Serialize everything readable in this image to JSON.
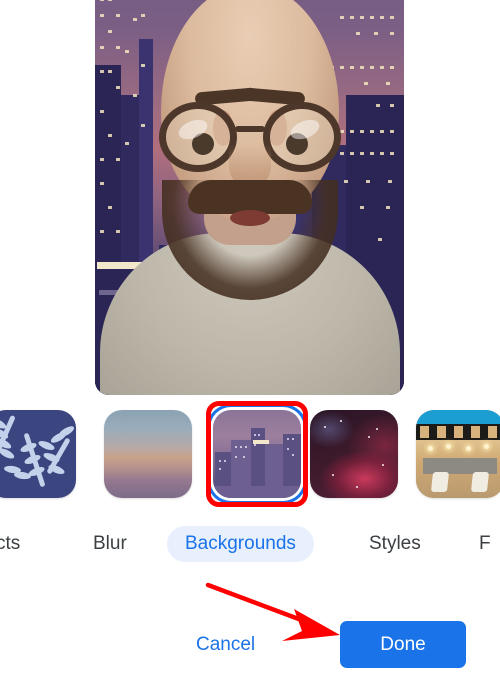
{
  "app": {
    "name": "video-call-background-effects-panel",
    "title": "Backgrounds"
  },
  "preview": {
    "name": "self-view-video-preview",
    "description": "Live self-view of a bearded person wearing glasses with a virtual night city skyline background applied",
    "alt_text": "Video preview"
  },
  "thumbnails": {
    "label": "Background options",
    "items": [
      {
        "id": "fern-cyanotype",
        "label": "Fern cyanotype background",
        "selected": false,
        "color": "#3b4580"
      },
      {
        "id": "sunset-gradient",
        "label": "Sunset gradient background",
        "selected": false,
        "color": "#b8a9a4"
      },
      {
        "id": "night-city",
        "label": "Night city skyline background",
        "selected": true,
        "color": "#8b7498"
      },
      {
        "id": "nebula-space",
        "label": "Red nebula space background",
        "selected": false,
        "color": "#58203a"
      },
      {
        "id": "patio-lounge",
        "label": "Outdoor patio lounge background",
        "selected": false,
        "color": "#c9a672"
      }
    ]
  },
  "tabs": {
    "items": [
      {
        "id": "effects",
        "label": "cts",
        "full_label": "Effects",
        "active": false,
        "truncated": true
      },
      {
        "id": "blur",
        "label": "Blur",
        "active": false,
        "truncated": false
      },
      {
        "id": "backgrounds",
        "label": "Backgrounds",
        "active": true,
        "truncated": false
      },
      {
        "id": "styles",
        "label": "Styles",
        "active": false,
        "truncated": false
      },
      {
        "id": "filters",
        "label": "F",
        "full_label": "Filters",
        "active": false,
        "truncated": true
      }
    ]
  },
  "footer": {
    "cancel_label": "Cancel",
    "done_label": "Done"
  },
  "annotations": {
    "highlight_target": "night-city background thumbnail",
    "arrow_target": "Done button",
    "color": "#ff0000"
  },
  "colors": {
    "accent_blue": "#1a73e8",
    "pill_background": "#e8f0fe",
    "text_primary": "#3c4043",
    "surface": "#ffffff",
    "annotation_red": "#ff0000"
  }
}
